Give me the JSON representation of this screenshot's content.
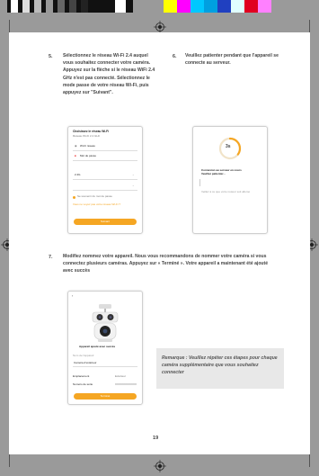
{
  "steps": {
    "s5": {
      "number": "5.",
      "text": "Sélectionnez le réseau Wi-Fi 2.4 auquel vous souhaitez connecter votre caméra. Appuyez sur la flèche si le réseau WiFi 2.4 GHz n'est pas connecté. Sélectionnez le mode passe de votre réseau Wi-Fi, puis appuyez sur \"Suivant\"."
    },
    "s6": {
      "number": "6.",
      "text": "Veuillez patienter pendant que l'appareil se connecte au serveur."
    },
    "s7": {
      "number": "7.",
      "text": "Modifiez nommez votre appareil. Nous vous recommandons de nommer votre caméra si vous connectez plusieurs caméras. Appuyez sur « Terminé ». Votre appareil a maintenant été ajouté avec succès"
    }
  },
  "phone1": {
    "title": "Choisissez le réseau Wi-Fi",
    "subtitle": "Réseau Wi-Fi 2.4 GHz",
    "network_label": "Wi-Fi réseau",
    "password_label": "Mot de passe",
    "field_value": "2.4G",
    "checkbox_label": "Se souvenir du mot de passe",
    "link": "Vous ne voyez pas votre réseau Wi-Fi ?",
    "button": "Suivant"
  },
  "phone2": {
    "progress_value": "3s",
    "progress_fraction": 0.35,
    "line1": "Connexion au serveur en cours",
    "line2": "Veuillez patienter...",
    "line3": "Veillez à ce que votre routeur soit allumé"
  },
  "phone3": {
    "caption": "Appareil ajouté avec succès",
    "name_label": "Nom de l'appareil",
    "name_value": "Caméra d'extérieur",
    "row1_label": "Emplacement",
    "row1_value": "Extérieur",
    "row2_label": "Numéro de série",
    "row2_value": "XXXXXXXXXXXX",
    "button": "Terminé"
  },
  "note": "Remarque : Veuillez répéter ces étapes pour chaque caméra supplémentaire que vous souhaitez connecter",
  "page_number": "19",
  "colors": {
    "accent": "#f5a623",
    "swatches": [
      "#ffff00",
      "#ff00ff",
      "#00c8ff",
      "#00a0e0",
      "#2040c0",
      "#e0ffff",
      "#e00020",
      "#ff80ff"
    ]
  }
}
